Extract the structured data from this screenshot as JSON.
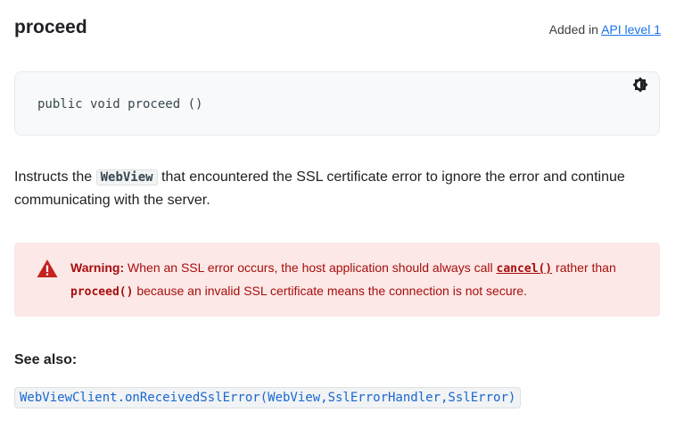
{
  "method": {
    "name": "proceed",
    "added_prefix": "Added in ",
    "api_link": "API level 1"
  },
  "signature": {
    "code": "public void proceed ()",
    "theme_icon": "brightness-icon"
  },
  "description": {
    "before": "Instructs the ",
    "code": "WebView",
    "after": " that encountered the SSL certificate error to ignore the error and continue communicating with the server."
  },
  "warning": {
    "icon": "warning-triangle-icon",
    "label": "Warning:",
    "text1": " When an SSL error occurs, the host application should always call ",
    "cancel_link": "cancel()",
    "text2": " rather than ",
    "proceed_code": "proceed()",
    "text3": " because an invalid SSL certificate means the connection is not secure."
  },
  "see_also": {
    "heading": "See also:",
    "link": "WebViewClient.onReceivedSslError(WebView,SslErrorHandler,SslError)"
  },
  "colors": {
    "warning_background": "#fce8e6",
    "warning_text": "#a50e0e",
    "link": "#1a73e8",
    "code_link": "#1967d2"
  }
}
